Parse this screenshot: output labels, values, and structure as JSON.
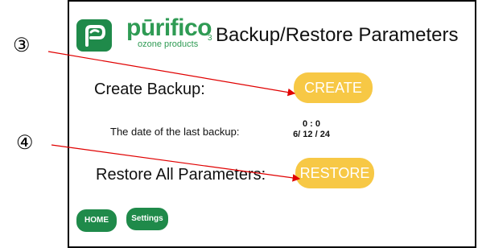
{
  "header": {
    "logo_letter": "P",
    "brand": "pūrifico",
    "brand_tagline": "ozone products",
    "brand_suffix": "3",
    "title": "Backup/Restore Parameters"
  },
  "backup": {
    "label": "Create Backup:",
    "button": "CREATE",
    "last_backup_label": "The date of the last backup:",
    "last_backup_time": "0 : 0",
    "last_backup_date": "6/ 12 / 24"
  },
  "restore": {
    "label": "Restore All Parameters:",
    "button": "RESTORE"
  },
  "nav": {
    "home": "HOME",
    "settings": "Settings"
  },
  "annotations": {
    "marker_3": "③",
    "marker_4": "④"
  },
  "colors": {
    "brand_green": "#2f9b54",
    "button_yellow": "#f7c845",
    "nav_green": "#1f8a4a",
    "arrow_red": "#e00000"
  }
}
